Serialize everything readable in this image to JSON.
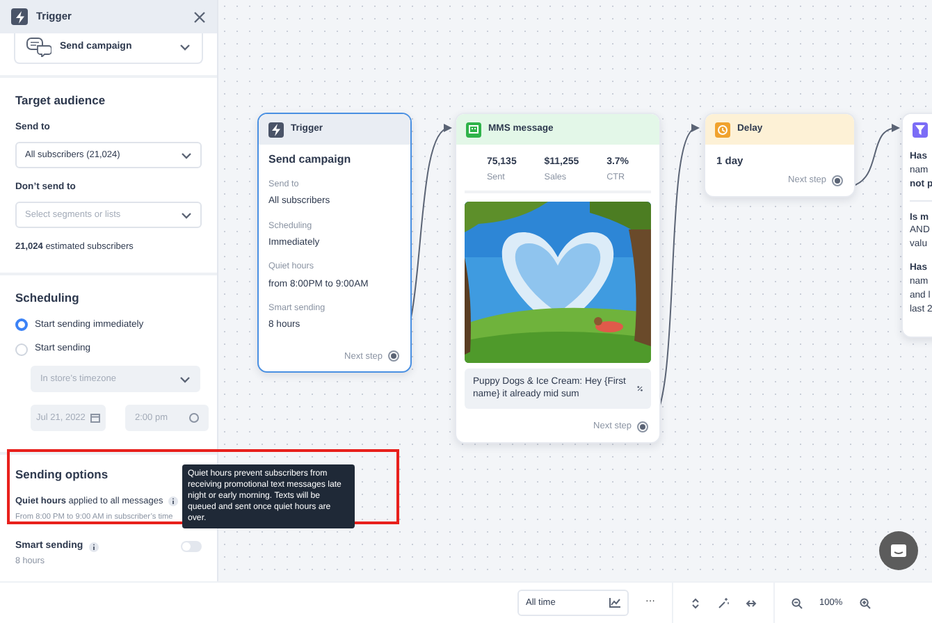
{
  "panel": {
    "title": "Trigger",
    "trigger": "Send campaign",
    "audience": {
      "heading": "Target audience",
      "send_to_label": "Send to",
      "send_to_value": "All subscribers (21,024)",
      "exclude_label": "Don’t send to",
      "exclude_placeholder": "Select segments or lists",
      "estimate": "**21,024** estimated subscribers"
    },
    "scheduling": {
      "heading": "Scheduling",
      "options": [
        {
          "label": "Start sending immediately",
          "selected": true
        },
        {
          "label": "Start sending",
          "selected": false
        }
      ],
      "timezone": "In store’s timezone",
      "date": "Jul 21, 2022",
      "time": "2:00 pm"
    },
    "sending_options": {
      "heading": "Sending options",
      "highlighted": true,
      "quiet_hours": "**Quiet hours** applied to all messages",
      "quiet_detail": "From 8:00 PM to 9:00 AM in subscriber’s time",
      "tooltip": "Quiet hours prevent subscribers from receiving promotional text messages late night or early morning. Texts will be queued and sent once quiet hours are over.",
      "smart_label": "Smart sending",
      "smart_detail": "8 hours",
      "smart_on": false
    }
  },
  "canvas": {
    "nodes": [
      {
        "kind": "trigger",
        "title": "Trigger",
        "selected": true,
        "heading": "Send campaign",
        "fields": [
          {
            "label": "Send to",
            "value": "All subscribers"
          },
          {
            "label": "Scheduling",
            "value": "Immediately"
          },
          {
            "label": "Quiet hours",
            "value": "from 8:00PM to 9:00AM"
          },
          {
            "label": "Smart sending",
            "value": "8 hours"
          }
        ],
        "next": "Next step"
      },
      {
        "kind": "mms",
        "title": "MMS message",
        "selected": false,
        "stats": [
          {
            "value": "75,135",
            "label": "Sent"
          },
          {
            "value": "$11,255",
            "label": "Sales"
          },
          {
            "value": "3.7%",
            "label": "CTR"
          }
        ],
        "message": "Puppy Dogs & Ice Cream: Hey {First name} it already mid sum",
        "next": "Next step"
      },
      {
        "kind": "delay",
        "title": "Delay",
        "selected": false,
        "heading": "1 day",
        "next": "Next step"
      },
      {
        "kind": "filter",
        "selected": false,
        "groups": [
          [
            "**Has**",
            "nam",
            "**not p**"
          ],
          [
            "**Is m**",
            "AND",
            "valu"
          ],
          [
            "**Has**",
            "nam",
            "and l",
            "last 2"
          ]
        ]
      }
    ]
  },
  "toolbar": {
    "range": "All time",
    "more": "···",
    "zoom": "100%"
  }
}
